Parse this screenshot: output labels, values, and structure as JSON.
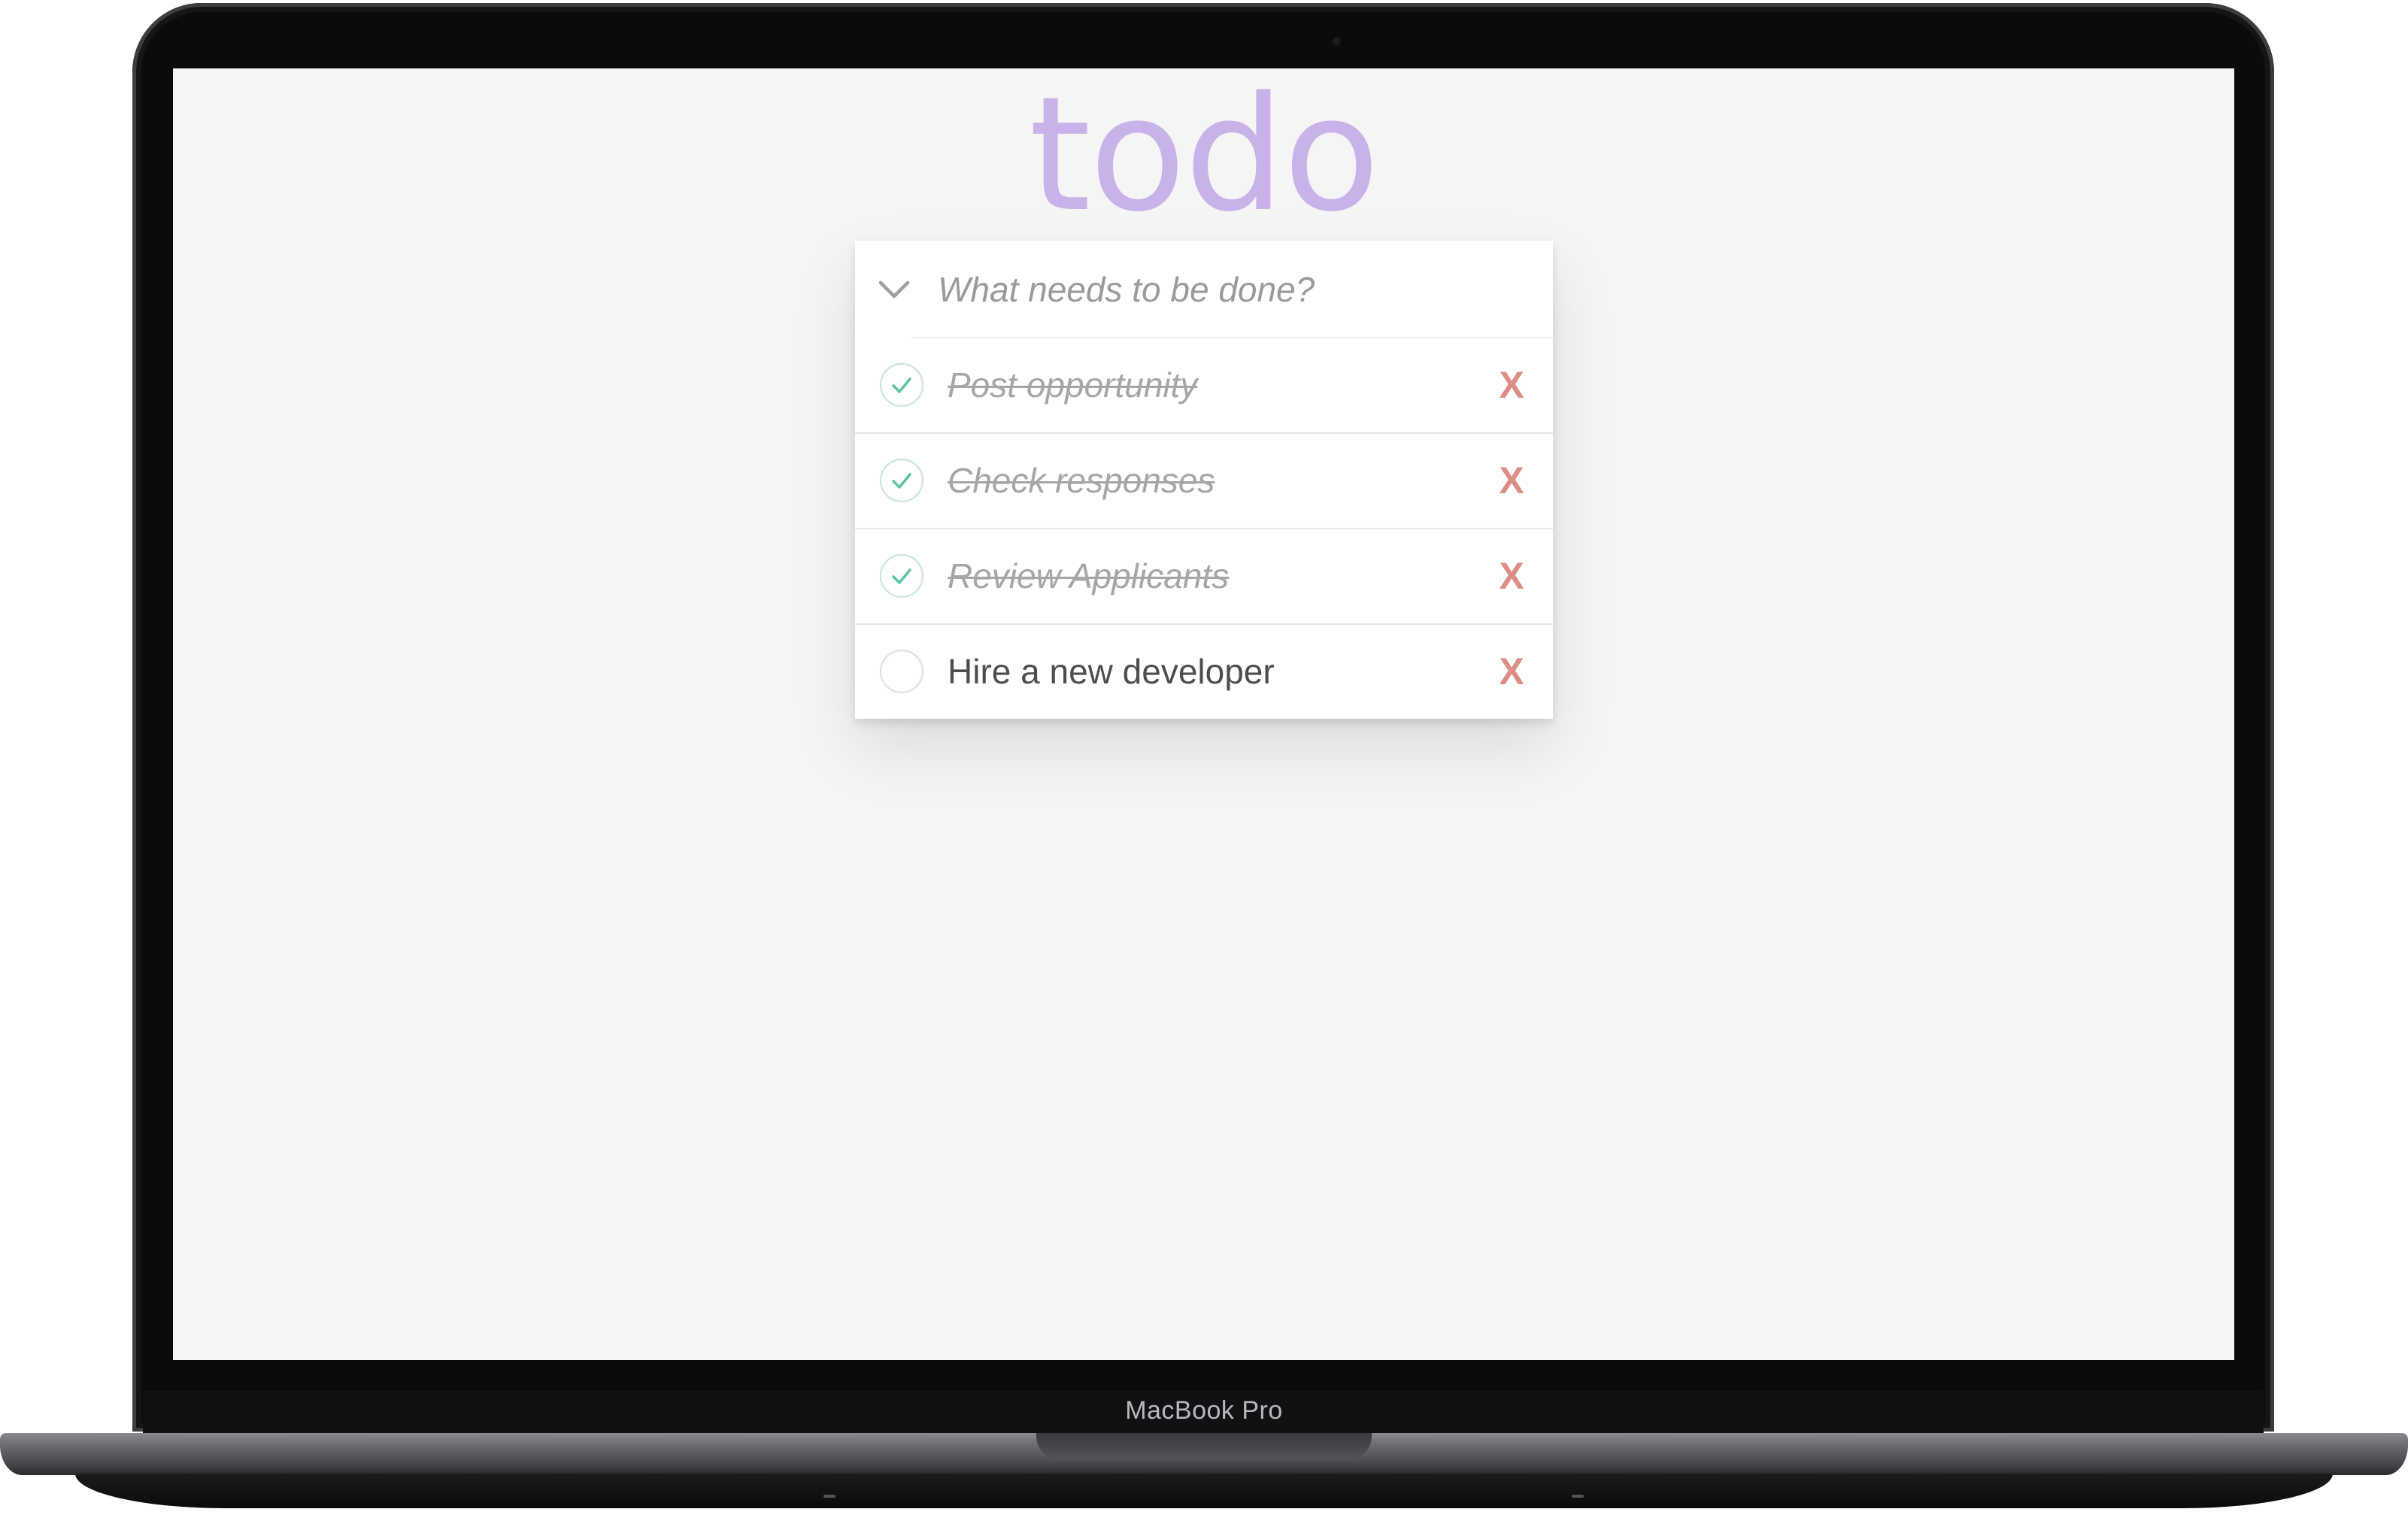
{
  "device": {
    "label": "MacBook Pro"
  },
  "app": {
    "title": "todo",
    "new_todo": {
      "placeholder": "What needs to be done?",
      "value": ""
    },
    "todos": [
      {
        "label": "Post opportunity",
        "completed": true,
        "delete_label": "X"
      },
      {
        "label": "Check responses",
        "completed": true,
        "delete_label": "X"
      },
      {
        "label": "Review Applicants",
        "completed": true,
        "delete_label": "X"
      },
      {
        "label": "Hire a new developer",
        "completed": false,
        "delete_label": "X"
      }
    ]
  },
  "icons": {
    "toggle_all": "chevron-down-icon",
    "checked": "checkmark-circle-icon",
    "unchecked": "empty-circle-icon"
  },
  "colors": {
    "title": "#c9b2ea",
    "check": "#5dc2a4",
    "delete": "#dd8d86",
    "background": "#f5f5f5"
  }
}
